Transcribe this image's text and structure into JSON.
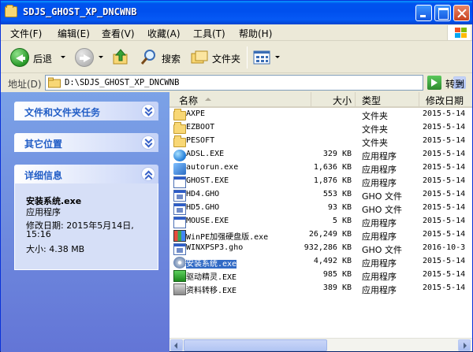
{
  "window": {
    "title": "SDJS_GHOST_XP_DNCWNB"
  },
  "menu": [
    "文件(F)",
    "编辑(E)",
    "查看(V)",
    "收藏(A)",
    "工具(T)",
    "帮助(H)"
  ],
  "toolbar": {
    "back_label": "后退",
    "search_label": "搜索",
    "folders_label": "文件夹"
  },
  "address": {
    "label": "地址(D)",
    "path": "D:\\SDJS_GHOST_XP_DNCWNB",
    "go_label": "转到"
  },
  "left_pane": {
    "tasks_title": "文件和文件夹任务",
    "other_places_title": "其它位置",
    "details_title": "详细信息",
    "details": {
      "name": "安装系统.exe",
      "type": "应用程序",
      "modified": "修改日期: 2015年5月14日,",
      "modified_time": "15:16",
      "size": "大小: 4.38 MB"
    }
  },
  "columns": {
    "name": "名称",
    "size": "大小",
    "type": "类型",
    "date": "修改日期"
  },
  "files": [
    {
      "name": "AXPE",
      "size": "",
      "type": "文件夹",
      "date": "2015-5-14",
      "icon": "folder-icon"
    },
    {
      "name": "EZBOOT",
      "size": "",
      "type": "文件夹",
      "date": "2015-5-14",
      "icon": "folder-icon"
    },
    {
      "name": "PESOFT",
      "size": "",
      "type": "文件夹",
      "date": "2015-5-14",
      "icon": "folder-icon"
    },
    {
      "name": "ADSL.EXE",
      "size": "329 KB",
      "type": "应用程序",
      "date": "2015-5-14",
      "icon": "globe-icon"
    },
    {
      "name": "autorun.exe",
      "size": "1,636 KB",
      "type": "应用程序",
      "date": "2015-5-14",
      "icon": "gear-icon"
    },
    {
      "name": "GHOST.EXE",
      "size": "1,876 KB",
      "type": "应用程序",
      "date": "2015-5-14",
      "icon": "exe-icon"
    },
    {
      "name": "HD4.GHO",
      "size": "553 KB",
      "type": "GHO 文件",
      "date": "2015-5-14",
      "icon": "gho-file-icon"
    },
    {
      "name": "HD5.GHO",
      "size": "93 KB",
      "type": "GHO 文件",
      "date": "2015-5-14",
      "icon": "gho-file-icon"
    },
    {
      "name": "MOUSE.EXE",
      "size": "5 KB",
      "type": "应用程序",
      "date": "2015-5-14",
      "icon": "exe-icon"
    },
    {
      "name": "WinPE加强硬盘版.exe",
      "size": "26,249 KB",
      "type": "应用程序",
      "date": "2015-5-14",
      "icon": "winpe-icon"
    },
    {
      "name": "WINXPSP3.gho",
      "size": "932,286 KB",
      "type": "GHO 文件",
      "date": "2016-10-3",
      "icon": "gho-file-icon"
    },
    {
      "name": "安装系统.exe",
      "size": "4,492 KB",
      "type": "应用程序",
      "date": "2015-5-14",
      "icon": "disk-icon",
      "selected": true
    },
    {
      "name": "驱动精灵.EXE",
      "size": "985 KB",
      "type": "应用程序",
      "date": "2015-5-14",
      "icon": "driver-icon"
    },
    {
      "name": "资料转移.EXE",
      "size": "389 KB",
      "type": "应用程序",
      "date": "2015-5-14",
      "icon": "transfer-icon"
    }
  ],
  "colors": {
    "titlebar": "#0053ee",
    "selection": "#316ac5",
    "task_pane": "#6375d6",
    "panel_heading": "#215dc6"
  }
}
